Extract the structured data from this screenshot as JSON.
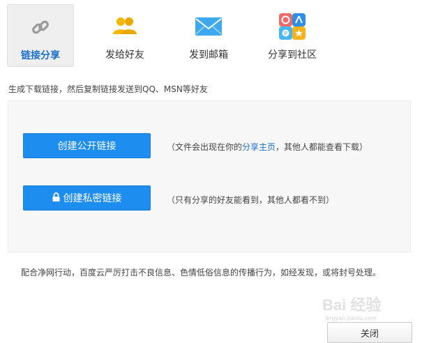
{
  "tabs": [
    {
      "label": "链接分享",
      "icon": "link-icon",
      "active": true
    },
    {
      "label": "发给好友",
      "icon": "friends-icon",
      "active": false
    },
    {
      "label": "发到邮箱",
      "icon": "mail-icon",
      "active": false
    },
    {
      "label": "分享到社区",
      "icon": "community-icon",
      "active": false
    }
  ],
  "description": "生成下载链接，然后复制链接发送到QQ、MSN等好友",
  "public_link": {
    "button_label": "创建公开链接",
    "note_before": "（文件会出现在你的",
    "note_link": "分享主页",
    "note_after": "，其他人都能查看下载）"
  },
  "private_link": {
    "button_label": "创建私密链接",
    "lock_icon": "lock-icon",
    "note": "（只有分享的好友能看到，其他人都看不到）"
  },
  "footer_text": "配合净网行动，百度云严厉打击不良信息、色情低俗信息的传播行为，如经发现，或将封号处理。",
  "watermark": {
    "text": "Bai 经验",
    "sub": "jingyan.baidu.com"
  },
  "close_button": "关闭",
  "colors": {
    "accent_blue": "#1d8ef0",
    "link_blue": "#1a6fc9",
    "friends_yellow": "#f5b800",
    "mail_blue": "#3fa9f0"
  }
}
